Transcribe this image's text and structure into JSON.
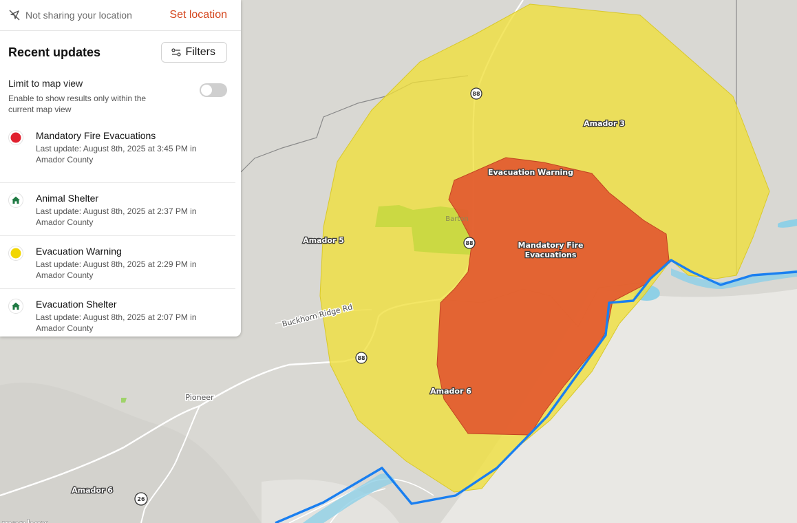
{
  "location_bar": {
    "status_text": "Not sharing your location",
    "set_location_label": "Set location"
  },
  "panel": {
    "title": "Recent updates",
    "filters_label": "Filters",
    "limit_title": "Limit to map view",
    "limit_description": "Enable to show results only within the current map view",
    "limit_enabled": false
  },
  "updates": [
    {
      "title": "Mandatory Fire Evacuations",
      "meta": "Last update: August 8th, 2025 at 3:45 PM in Amador County",
      "icon": "red-dot-icon",
      "color": "#e0202e"
    },
    {
      "title": "Animal Shelter",
      "meta": "Last update: August 8th, 2025 at 2:37 PM in Amador County",
      "icon": "house-icon",
      "color": "#1f7a43"
    },
    {
      "title": "Evacuation Warning",
      "meta": "Last update: August 8th, 2025 at 2:29 PM in Amador County",
      "icon": "yellow-dot-icon",
      "color": "#f2d600"
    },
    {
      "title": "Evacuation Shelter",
      "meta": "Last update: August 8th, 2025 at 2:07 PM in Amador County",
      "icon": "house-icon",
      "color": "#1f7a43"
    }
  ],
  "map": {
    "labels": {
      "amador3": "Amador 3",
      "amador5": "Amador 5",
      "amador6_zone": "Amador 6",
      "amador6_outside": "Amador 6",
      "evac_warning": "Evacuation Warning",
      "mandatory_line1": "Mandatory Fire",
      "mandatory_line2": "Evacuations",
      "barton": "Barton",
      "pioneer": "Pioneer",
      "buckhorn": "Buckhorn Ridge Rd"
    },
    "shields": {
      "hwy88": "88",
      "hwy26": "26"
    },
    "attribution": "mapbox",
    "colors": {
      "warning_zone": "#efdf3a",
      "mandatory_zone": "#e2572f",
      "county_line": "#1a7ff0",
      "water": "#8fd0e6"
    }
  }
}
